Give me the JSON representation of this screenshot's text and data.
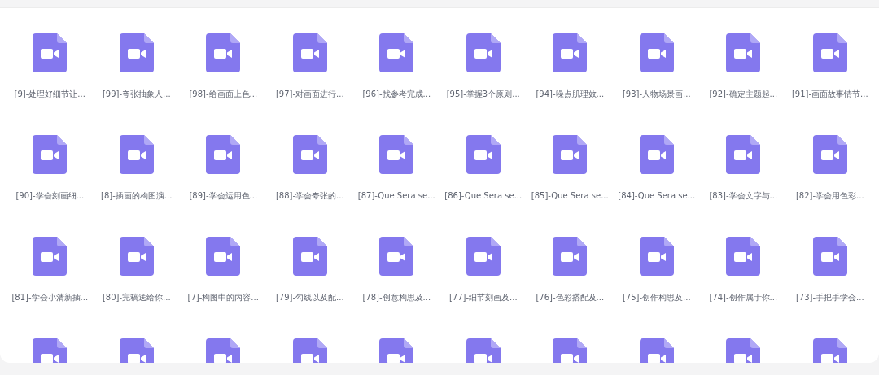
{
  "files": [
    {
      "kind": "video",
      "title": "[9]-处理好细节让..."
    },
    {
      "kind": "video",
      "title": "[99]-夸张抽象人..."
    },
    {
      "kind": "video",
      "title": "[98]-给画面上色..."
    },
    {
      "kind": "video",
      "title": "[97]-对画面进行..."
    },
    {
      "kind": "video",
      "title": "[96]-找参考完成..."
    },
    {
      "kind": "video",
      "title": "[95]-掌握3个原则..."
    },
    {
      "kind": "video",
      "title": "[94]-噪点肌理效..."
    },
    {
      "kind": "video",
      "title": "[93]-人物场景画..."
    },
    {
      "kind": "video",
      "title": "[92]-确定主题起..."
    },
    {
      "kind": "video",
      "title": "[91]-画面故事情节..."
    },
    {
      "kind": "video",
      "title": "[90]-学会刻画细..."
    },
    {
      "kind": "video",
      "title": "[8]-插画的构图演..."
    },
    {
      "kind": "video",
      "title": "[89]-学会运用色..."
    },
    {
      "kind": "video",
      "title": "[88]-学会夸张的..."
    },
    {
      "kind": "video",
      "title": "[87]-Que Sera se..."
    },
    {
      "kind": "video",
      "title": "[86]-Que Sera se..."
    },
    {
      "kind": "video",
      "title": "[85]-Que Sera se..."
    },
    {
      "kind": "video",
      "title": "[84]-Que Sera se..."
    },
    {
      "kind": "video",
      "title": "[83]-学会文字与..."
    },
    {
      "kind": "video",
      "title": "[82]-学会用色彩..."
    },
    {
      "kind": "video",
      "title": "[81]-学会小清新插..."
    },
    {
      "kind": "video",
      "title": "[80]-完稿送给你..."
    },
    {
      "kind": "video",
      "title": "[7]-构图中的内容..."
    },
    {
      "kind": "video",
      "title": "[79]-勾线以及配..."
    },
    {
      "kind": "video",
      "title": "[78]-创意构思及..."
    },
    {
      "kind": "video",
      "title": "[77]-细节刻画及..."
    },
    {
      "kind": "video",
      "title": "[76]-色彩搭配及..."
    },
    {
      "kind": "video",
      "title": "[75]-创作构思及..."
    },
    {
      "kind": "video",
      "title": "[74]-创作属于你..."
    },
    {
      "kind": "video",
      "title": "[73]-手把手学会..."
    },
    {
      "kind": "video"
    },
    {
      "kind": "video"
    },
    {
      "kind": "video"
    },
    {
      "kind": "video"
    },
    {
      "kind": "video"
    },
    {
      "kind": "video"
    },
    {
      "kind": "video"
    },
    {
      "kind": "video"
    },
    {
      "kind": "video"
    },
    {
      "kind": "video"
    }
  ]
}
